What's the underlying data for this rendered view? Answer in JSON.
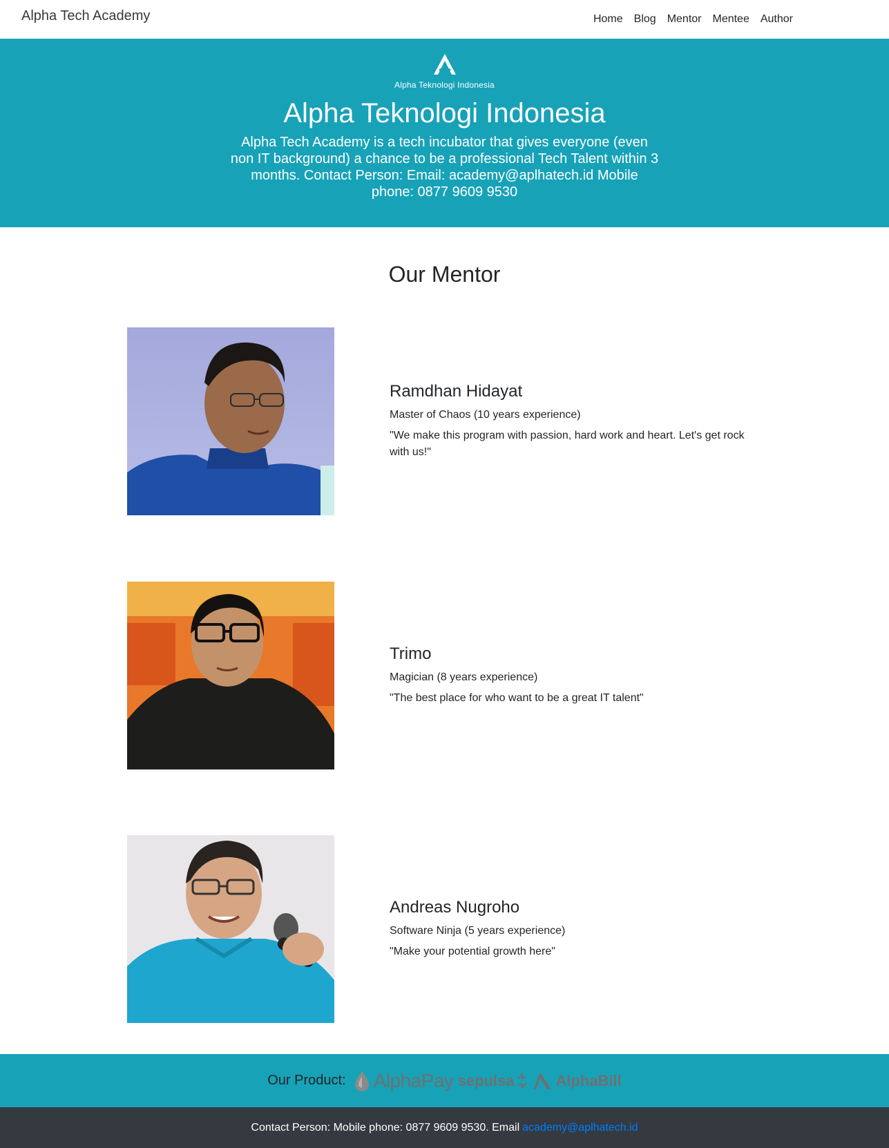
{
  "navbar": {
    "brand": "Alpha Tech Academy",
    "links": [
      "Home",
      "Blog",
      "Mentor",
      "Mentee",
      "Author"
    ]
  },
  "hero": {
    "logo_caption": "Alpha Teknologi Indonesia",
    "title": "Alpha Teknologi Indonesia",
    "description": "Alpha Tech Academy is a tech incubator that gives everyone (even non IT background) a chance to be a professional Tech Talent within 3 months. Contact Person: Email: academy@aplhatech.id Mobile phone: 0877 9609 9530",
    "background_color": "#17a2b8"
  },
  "mentor_section": {
    "title": "Our Mentor",
    "mentors": [
      {
        "name": "Ramdhan Hidayat",
        "role": "Master of Chaos (10 years experience)",
        "quote": "\"We make this program with passion, hard work and heart. Let's get rock with us!\""
      },
      {
        "name": "Trimo",
        "role": "Magician (8 years experience)",
        "quote": "\"The best place for who want to be a great IT talent\""
      },
      {
        "name": "Andreas Nugroho",
        "role": "Software Ninja (5 years experience)",
        "quote": "\"Make your potential growth here\""
      }
    ]
  },
  "products": {
    "label": "Our Product:",
    "items": [
      "AlphaPay",
      "sepulsa",
      "AlphaBill"
    ]
  },
  "footer": {
    "text": "Contact Person: Mobile phone: 0877 9609 9530. Email",
    "email": "academy@aplhatech.id",
    "link_color": "#007bff",
    "background_color": "#343a40"
  }
}
